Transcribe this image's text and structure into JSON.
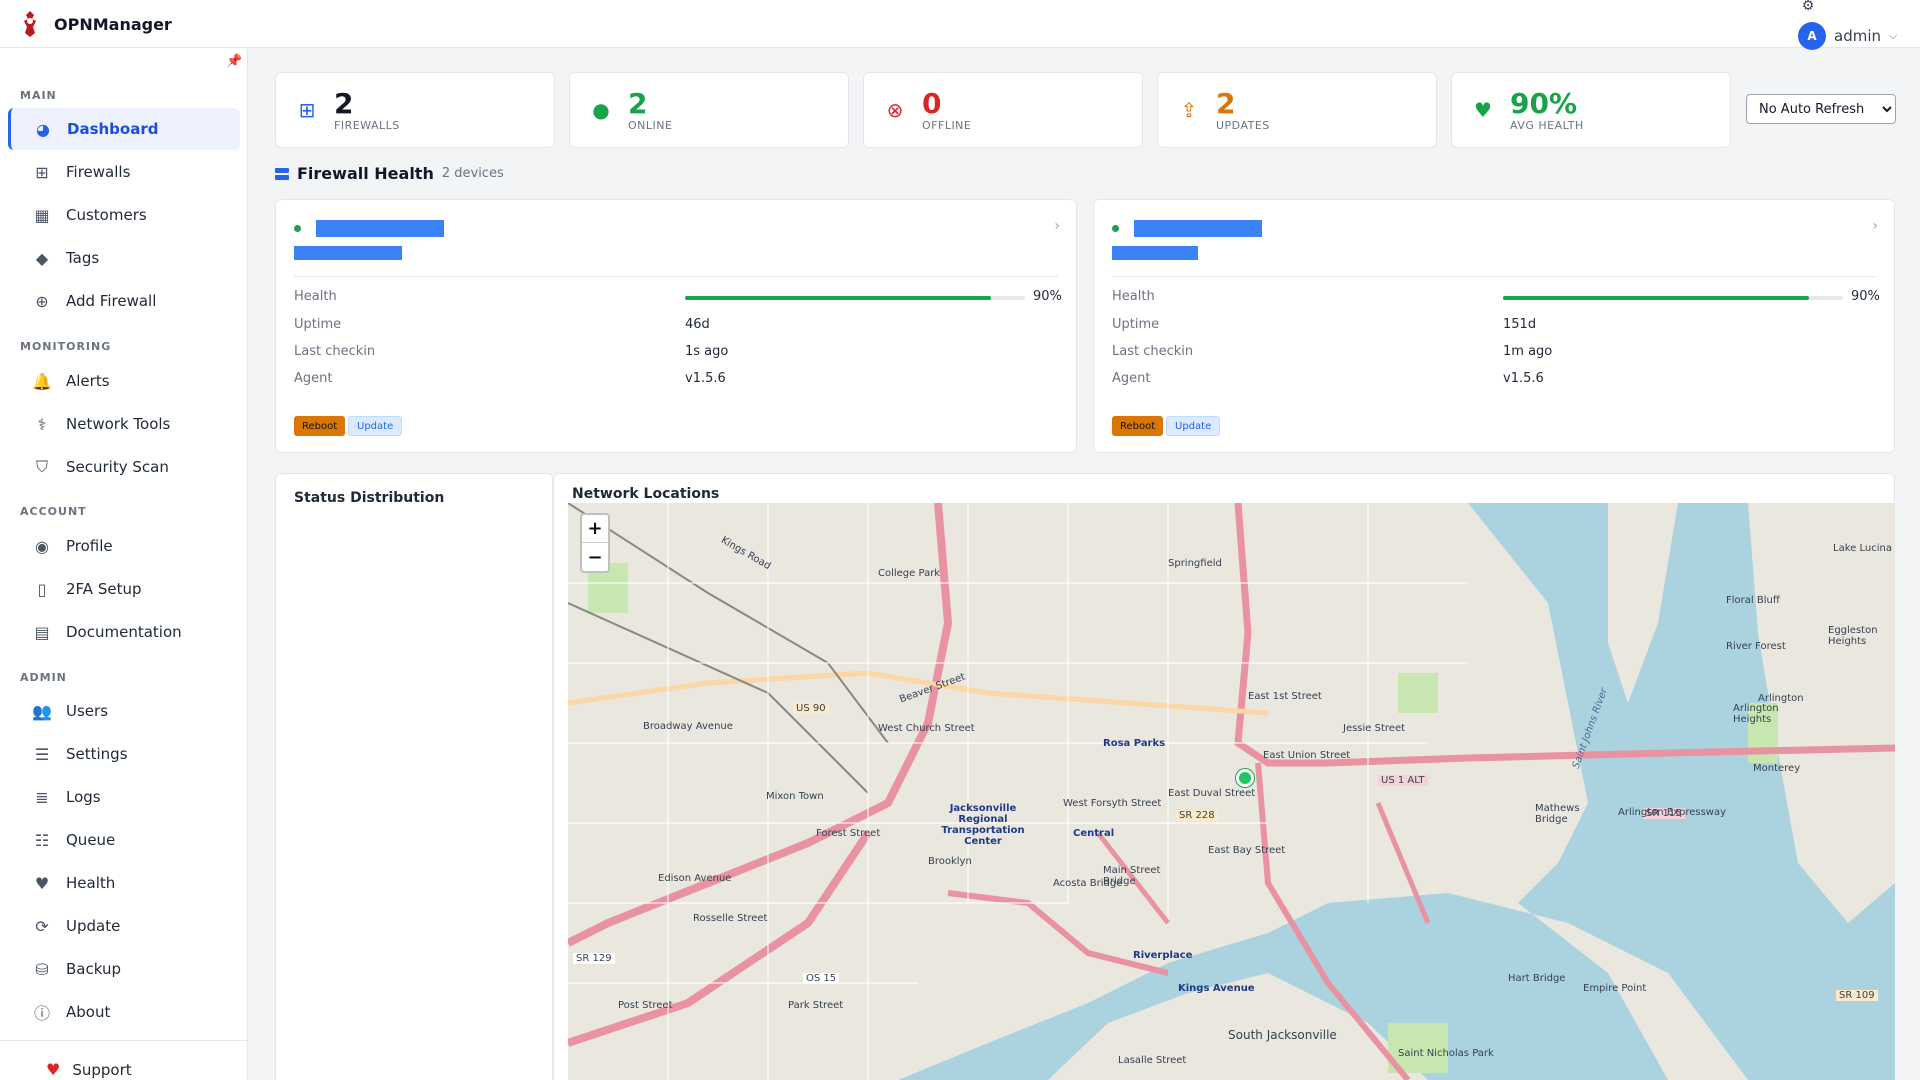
{
  "app": {
    "title": "OPNManager"
  },
  "header": {
    "user_initial": "A",
    "user_name": "admin"
  },
  "sidebar": {
    "sections": [
      {
        "title": "MAIN",
        "items": [
          {
            "label": "Dashboard",
            "icon": "dashboard-icon",
            "active": true
          },
          {
            "label": "Firewalls",
            "icon": "network-icon"
          },
          {
            "label": "Customers",
            "icon": "building-icon"
          },
          {
            "label": "Tags",
            "icon": "tags-icon"
          },
          {
            "label": "Add Firewall",
            "icon": "plus-circle-icon"
          }
        ]
      },
      {
        "title": "MONITORING",
        "items": [
          {
            "label": "Alerts",
            "icon": "bell-icon"
          },
          {
            "label": "Network Tools",
            "icon": "stethoscope-icon"
          },
          {
            "label": "Security Scan",
            "icon": "shield-icon"
          }
        ]
      },
      {
        "title": "ACCOUNT",
        "items": [
          {
            "label": "Profile",
            "icon": "user-circle-icon"
          },
          {
            "label": "2FA Setup",
            "icon": "mobile-icon"
          },
          {
            "label": "Documentation",
            "icon": "book-icon"
          }
        ]
      },
      {
        "title": "ADMIN",
        "items": [
          {
            "label": "Users",
            "icon": "users-icon"
          },
          {
            "label": "Settings",
            "icon": "sliders-icon"
          },
          {
            "label": "Logs",
            "icon": "list-icon"
          },
          {
            "label": "Queue",
            "icon": "tasks-icon"
          },
          {
            "label": "Health",
            "icon": "heartbeat-icon"
          },
          {
            "label": "Update",
            "icon": "sync-icon"
          },
          {
            "label": "Backup",
            "icon": "database-icon"
          },
          {
            "label": "About",
            "icon": "info-icon"
          }
        ]
      }
    ],
    "support_label": "Support"
  },
  "stats": [
    {
      "value": "2",
      "label": "FIREWALLS",
      "color": "#111827",
      "icon_color": "#2563eb"
    },
    {
      "value": "2",
      "label": "ONLINE",
      "color": "#16a34a",
      "icon_color": "#16a34a"
    },
    {
      "value": "0",
      "label": "OFFLINE",
      "color": "#dc2626",
      "icon_color": "#dc2626"
    },
    {
      "value": "2",
      "label": "UPDATES",
      "color": "#d97706",
      "icon_color": "#d97706"
    },
    {
      "value": "90%",
      "label": "AVG HEALTH",
      "color": "#16a34a",
      "icon_color": "#16a34a"
    }
  ],
  "refresh": {
    "selected": "No Auto Refresh"
  },
  "firewall_health": {
    "title": "Firewall Health",
    "count": "2 devices",
    "labels": {
      "health": "Health",
      "uptime": "Uptime",
      "last_checkin": "Last checkin",
      "agent": "Agent"
    },
    "devices": [
      {
        "health_pct": 90,
        "health_text": "90%",
        "uptime": "46d",
        "last_checkin": "1s ago",
        "agent": "v1.5.6",
        "reboot_label": "Reboot",
        "update_label": "Update"
      },
      {
        "health_pct": 90,
        "health_text": "90%",
        "uptime": "151d",
        "last_checkin": "1m ago",
        "agent": "v1.5.6",
        "reboot_label": "Reboot",
        "update_label": "Update"
      }
    ]
  },
  "status_distribution": {
    "title": "Status Distribution"
  },
  "network_locations": {
    "title": "Network Locations",
    "zoom_in": "+",
    "zoom_out": "−",
    "labels": [
      "College Park",
      "Springfield",
      "Kings Road",
      "Beaver Street",
      "Rosa Parks",
      "Central",
      "Jacksonville Regional Transportation Center",
      "Brooklyn",
      "Mixon Town",
      "Main Street Bridge",
      "Acosta Bridge",
      "Riverplace",
      "Kings Avenue",
      "South Jacksonville",
      "Mathews Bridge",
      "Hart Bridge",
      "Arlington",
      "Floral Bluff",
      "Eggleston Heights",
      "Saint Johns River",
      "US 1 ALT",
      "SR 115",
      "SR 228",
      "US 90",
      "Lake Lucina",
      "Arlington Expressway",
      "East Union Street",
      "West Church Street",
      "Forest Street",
      "Edison Avenue",
      "Rosselle Street",
      "Post Street",
      "Park Street",
      "OS 15",
      "SR 129",
      "SR 109",
      "Lasalle Street",
      "Empire Point",
      "Saint Nicholas Park",
      "Jessie Street",
      "East 1st Street",
      "Arlington Heights",
      "River Forest",
      "Monterey",
      "East Bay Street",
      "East Duval Street",
      "West Forsyth Street",
      "Broadway Avenue"
    ]
  }
}
